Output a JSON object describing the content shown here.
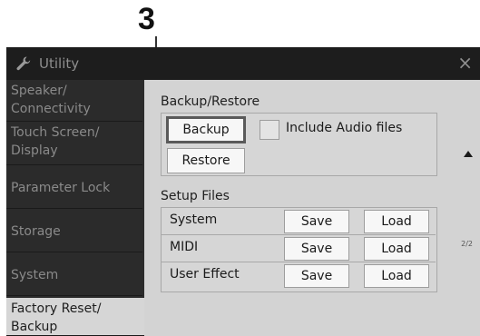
{
  "callout": {
    "number": "3"
  },
  "window": {
    "title": "Utility",
    "title_icon": "wrench-icon",
    "close_glyph": "×"
  },
  "sidebar": {
    "items": [
      {
        "label": "Speaker/\nConnectivity",
        "active": false
      },
      {
        "label": "Touch Screen/\nDisplay",
        "active": false
      },
      {
        "label": "Parameter Lock",
        "active": false
      },
      {
        "label": "Storage",
        "active": false
      },
      {
        "label": "System",
        "active": false
      },
      {
        "label": "Factory Reset/\nBackup",
        "active": true
      }
    ]
  },
  "main": {
    "backup_restore": {
      "heading": "Backup/Restore",
      "backup_label": "Backup",
      "restore_label": "Restore",
      "include_audio_label": "Include Audio files",
      "include_audio_checked": false
    },
    "setup_files": {
      "heading": "Setup Files",
      "rows": [
        {
          "label": "System",
          "save": "Save",
          "load": "Load"
        },
        {
          "label": "MIDI",
          "save": "Save",
          "load": "Load"
        },
        {
          "label": "User Effect",
          "save": "Save",
          "load": "Load"
        }
      ]
    },
    "page_indicator": "2/2"
  },
  "colors": {
    "titlebar": "#1d1d1d",
    "sidebar": "#2b2b2b",
    "main_bg": "#d3d3d3",
    "button": "#f7f7f7"
  }
}
